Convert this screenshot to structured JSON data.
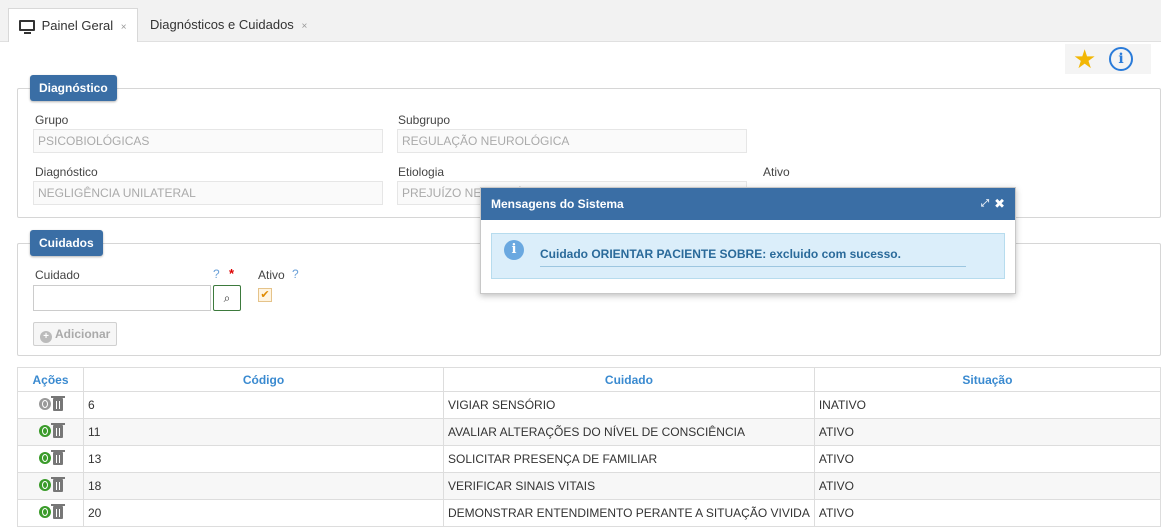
{
  "tabs": [
    {
      "label": "Painel Geral",
      "close": "×",
      "active": true
    },
    {
      "label": "Diagnósticos e Cuidados",
      "close": "×",
      "active": false
    }
  ],
  "toolbar": {
    "favorite_icon": "star-icon",
    "info_icon": "info-icon",
    "info_glyph": "i"
  },
  "diagnostico": {
    "legend": "Diagnóstico",
    "grupo_label": "Grupo",
    "grupo_value": "PSICOBIOLÓGICAS",
    "subgrupo_label": "Subgrupo",
    "subgrupo_value": "REGULAÇÃO NEUROLÓGICA",
    "diagnostico_label": "Diagnóstico",
    "diagnostico_value": "NEGLIGÊNCIA UNILATERAL",
    "etiologia_label": "Etiologia",
    "etiologia_value": "PREJUÍZO NEUROLÓGICO",
    "ativo_label": "Ativo"
  },
  "cuidados": {
    "legend": "Cuidados",
    "cuidado_label": "Cuidado",
    "help": "?",
    "required": "*",
    "ativo_label": "Ativo",
    "ativo_help": "?",
    "cuidado_value": "",
    "search_glyph": "⌕",
    "checkbox_glyph": "✔",
    "add_label": "Adicionar",
    "add_glyph": "+"
  },
  "table": {
    "headers": [
      "Ações",
      "Código",
      "Cuidado",
      "Situação"
    ],
    "rows": [
      {
        "codigo": "6",
        "cuidado": "VIGIAR SENSÓRIO",
        "situacao": "INATIVO",
        "active": false
      },
      {
        "codigo": "11",
        "cuidado": "AVALIAR ALTERAÇÕES DO NÍVEL DE CONSCIÊNCIA",
        "situacao": "ATIVO",
        "active": true
      },
      {
        "codigo": "13",
        "cuidado": "SOLICITAR PRESENÇA DE FAMILIAR",
        "situacao": "ATIVO",
        "active": true
      },
      {
        "codigo": "18",
        "cuidado": "VERIFICAR SINAIS VITAIS",
        "situacao": "ATIVO",
        "active": true
      },
      {
        "codigo": "20",
        "cuidado": "DEMONSTRAR ENTENDIMENTO PERANTE A SITUAÇÃO VIVIDA",
        "situacao": "ATIVO",
        "active": true
      }
    ]
  },
  "dialog": {
    "title": "Mensagens do Sistema",
    "expand_glyph": "⤢",
    "close_glyph": "✖",
    "info_glyph": "i",
    "message": "Cuidado ORIENTAR PACIENTE SOBRE: excluido com sucesso."
  },
  "colors": {
    "accent": "#3a6ea5",
    "header_text": "#3a8ad0",
    "active_toggle": "#3a9b2a",
    "star": "#f2b705"
  }
}
